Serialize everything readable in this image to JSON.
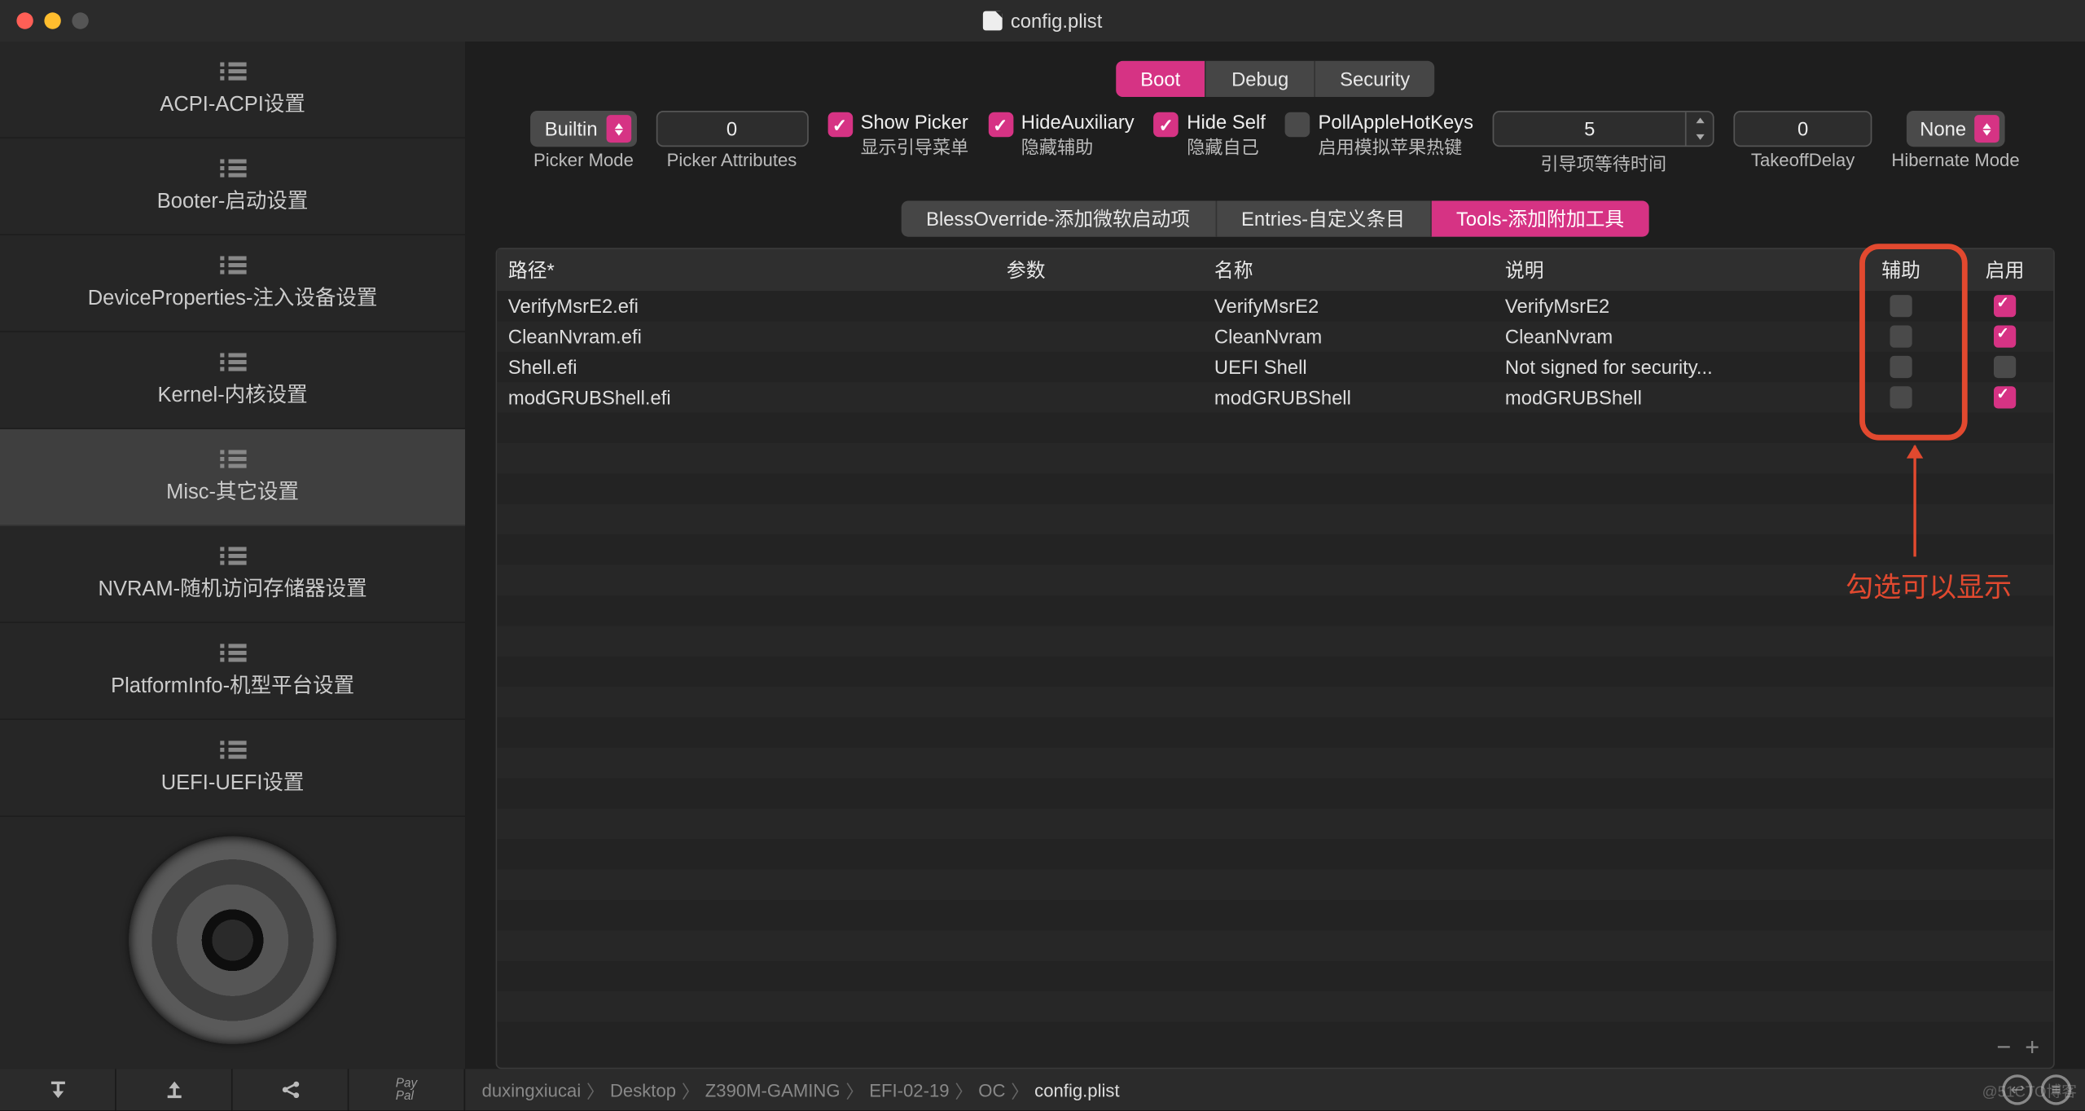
{
  "window": {
    "title": "config.plist"
  },
  "sidebar": {
    "items": [
      {
        "label": "ACPI-ACPI设置"
      },
      {
        "label": "Booter-启动设置"
      },
      {
        "label": "DeviceProperties-注入设备设置"
      },
      {
        "label": "Kernel-内核设置"
      },
      {
        "label": "Misc-其它设置"
      },
      {
        "label": "NVRAM-随机访问存储器设置"
      },
      {
        "label": "PlatformInfo-机型平台设置"
      },
      {
        "label": "UEFI-UEFI设置"
      }
    ],
    "selected_index": 4
  },
  "top_tabs": {
    "items": [
      "Boot",
      "Debug",
      "Security"
    ],
    "active_index": 0
  },
  "options": {
    "picker_mode": {
      "value": "Builtin",
      "label": "Picker Mode"
    },
    "picker_attributes": {
      "value": "0",
      "label": "Picker Attributes"
    },
    "show_picker": {
      "checked": true,
      "title": "Show Picker",
      "sub": "显示引导菜单"
    },
    "hide_auxiliary": {
      "checked": true,
      "title": "HideAuxiliary",
      "sub": "隐藏辅助"
    },
    "hide_self": {
      "checked": true,
      "title": "Hide Self",
      "sub": "隐藏自己"
    },
    "poll_apple": {
      "checked": false,
      "title": "PollAppleHotKeys",
      "sub": "启用模拟苹果热键"
    },
    "timeout": {
      "value": "5",
      "label": "引导项等待时间"
    },
    "takeoff_delay": {
      "value": "0",
      "label": "TakeoffDelay"
    },
    "hibernate": {
      "value": "None",
      "label": "Hibernate Mode"
    }
  },
  "sub_tabs": {
    "items": [
      "BlessOverride-添加微软启动项",
      "Entries-自定义条目",
      "Tools-添加附加工具"
    ],
    "active_index": 2
  },
  "table": {
    "columns": {
      "path": "路径*",
      "args": "参数",
      "name": "名称",
      "desc": "说明",
      "aux": "辅助",
      "enabled": "启用"
    },
    "rows": [
      {
        "path": "VerifyMsrE2.efi",
        "args": "",
        "name": "VerifyMsrE2",
        "desc": "VerifyMsrE2",
        "aux": false,
        "enabled": true
      },
      {
        "path": "CleanNvram.efi",
        "args": "",
        "name": "CleanNvram",
        "desc": "CleanNvram",
        "aux": false,
        "enabled": true
      },
      {
        "path": "Shell.efi",
        "args": "",
        "name": "UEFI Shell",
        "desc": "Not signed for security...",
        "aux": false,
        "enabled": false
      },
      {
        "path": "modGRUBShell.efi",
        "args": "",
        "name": "modGRUBShell",
        "desc": "modGRUBShell",
        "aux": false,
        "enabled": true
      }
    ],
    "footer": {
      "remove": "−",
      "add": "+"
    }
  },
  "annotation": {
    "text": "勾选可以显示"
  },
  "breadcrumbs": [
    "duxingxiucai",
    "Desktop",
    "Z390M-GAMING",
    "EFI-02-19",
    "OC",
    "config.plist"
  ],
  "footer_tools": {
    "import": "⤓",
    "export": "⤒",
    "share": "⋔",
    "paypal": "Pay\nPal"
  },
  "footer_right": {
    "back": "←",
    "menu": "≡"
  },
  "watermark": "@51CTO博客"
}
